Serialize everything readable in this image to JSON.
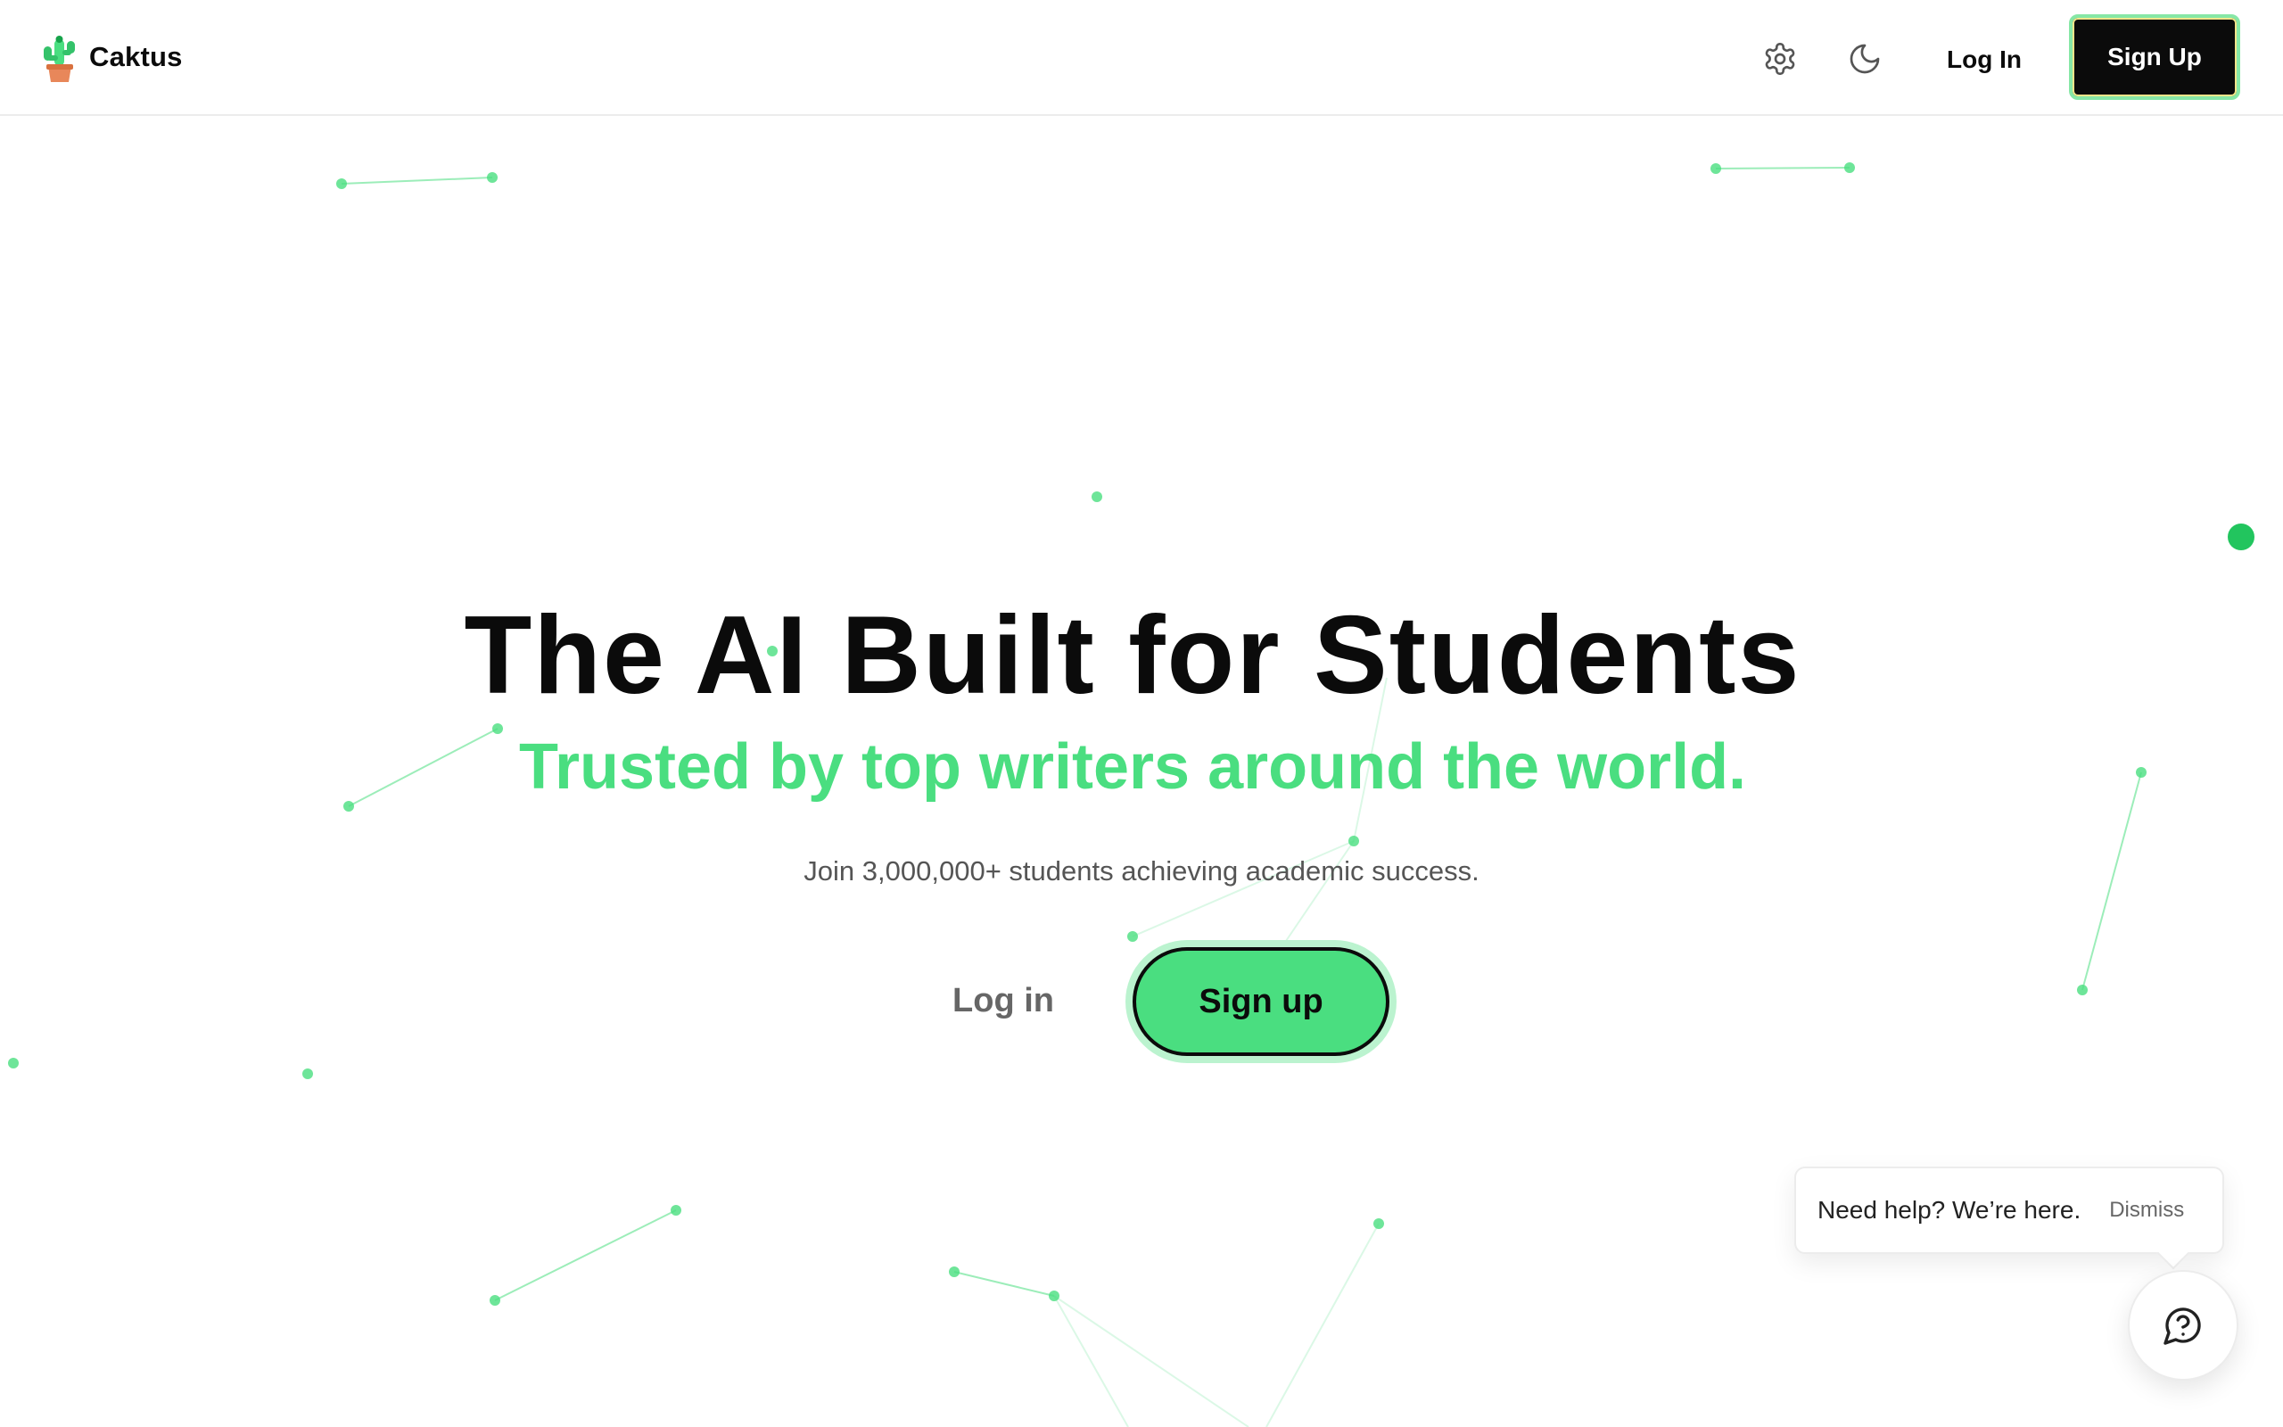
{
  "header": {
    "brand_name": "Caktus",
    "settings_icon": "gear-icon",
    "theme_icon": "moon-icon",
    "login_label": "Log In",
    "signup_label": "Sign Up"
  },
  "hero": {
    "title": "The AI Built for Students",
    "subtitle": "Trusted by top writers around the world.",
    "description": "Join 3,000,000+ students achieving academic success.",
    "login_label": "Log in",
    "signup_label": "Sign up"
  },
  "help_widget": {
    "message": "Need help? We’re here.",
    "dismiss_label": "Dismiss",
    "icon": "help-chat-icon"
  },
  "colors": {
    "brand_green": "#4ade80",
    "dark": "#0b0b0b",
    "muted_text": "#555555"
  }
}
